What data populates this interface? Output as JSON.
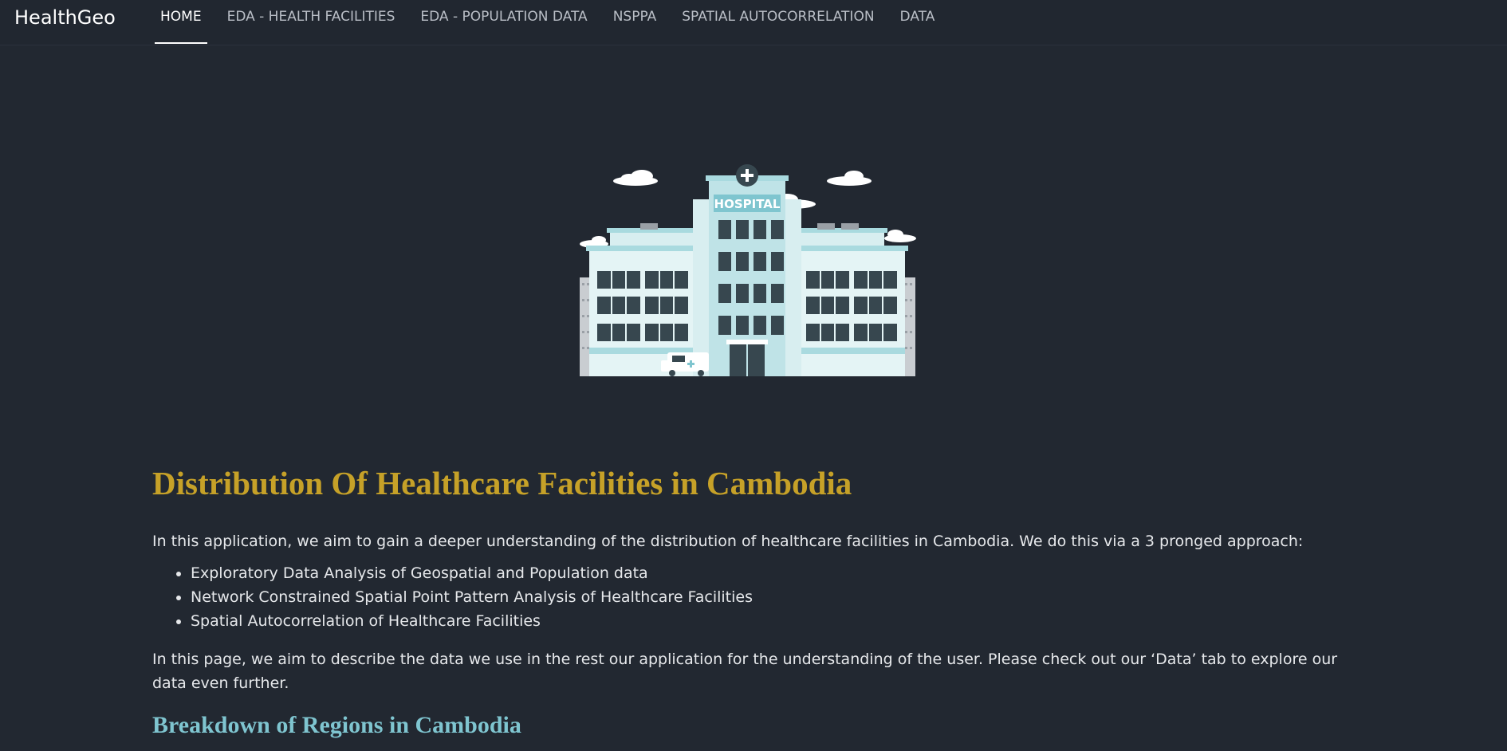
{
  "app": {
    "brand": "HealthGeo"
  },
  "nav": {
    "items": [
      {
        "label": "HOME",
        "active": true
      },
      {
        "label": "EDA - HEALTH FACILITIES",
        "active": false
      },
      {
        "label": "EDA - POPULATION DATA",
        "active": false
      },
      {
        "label": "NSPPA",
        "active": false
      },
      {
        "label": "SPATIAL AUTOCORRELATION",
        "active": false
      },
      {
        "label": "DATA",
        "active": false
      }
    ]
  },
  "hero": {
    "sign_text": "HOSPITAL",
    "icon": "hospital-building-illustration"
  },
  "main": {
    "title": "Distribution Of Healthcare Facilities in Cambodia",
    "intro": "In this application, we aim to gain a deeper understanding of the distribution of healthcare facilities in Cambodia. We do this via a 3 pronged approach:",
    "approaches": [
      "Exploratory Data Analysis of Geospatial and Population data",
      "Network Constrained Spatial Point Pattern Analysis of Healthcare Facilities",
      "Spatial Autocorrelation of Healthcare Facilities"
    ],
    "description": "In this page, we aim to describe the data we use in the rest our application for the understanding of the user. Please check out our ‘Data’ tab to explore our data even further.",
    "subtitle": "Breakdown of Regions in Cambodia"
  },
  "colors": {
    "background": "#222831",
    "title": "#c6a128",
    "subtitle": "#7fc5d0"
  }
}
